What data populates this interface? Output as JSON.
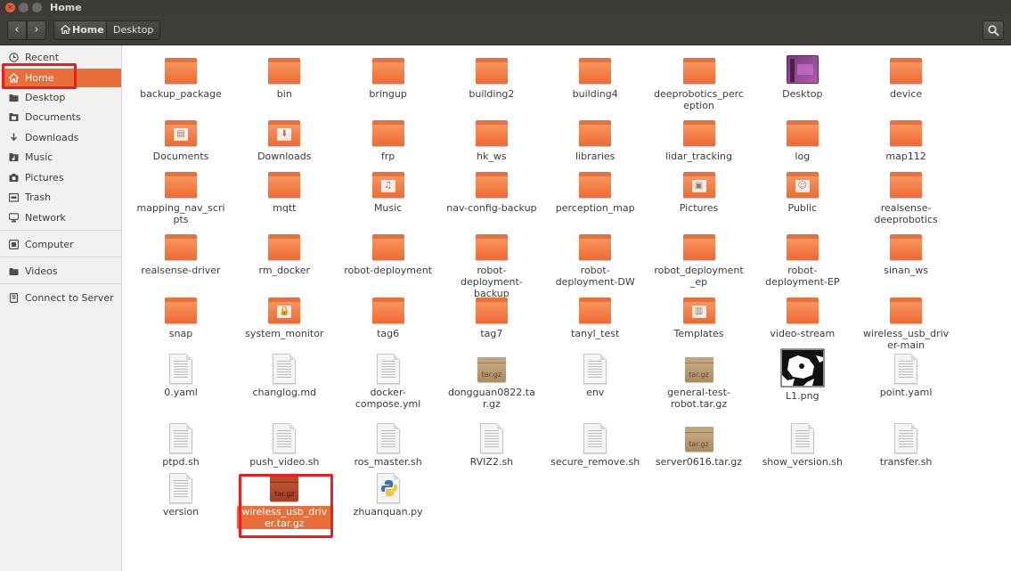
{
  "window": {
    "title": "Home"
  },
  "toolbar": {
    "back_icon": "‹",
    "forward_icon": "›",
    "breadcrumb": [
      "Home",
      "Desktop"
    ]
  },
  "sidebar": {
    "items": [
      {
        "label": "Recent",
        "icon": "clock-icon"
      },
      {
        "label": "Home",
        "icon": "home-icon",
        "active": true
      },
      {
        "label": "Desktop",
        "icon": "folder-icon"
      },
      {
        "label": "Documents",
        "icon": "document-icon"
      },
      {
        "label": "Downloads",
        "icon": "download-icon"
      },
      {
        "label": "Music",
        "icon": "music-icon"
      },
      {
        "label": "Pictures",
        "icon": "camera-icon"
      },
      {
        "label": "Trash",
        "icon": "trash-icon"
      },
      {
        "label": "Network",
        "icon": "network-icon"
      },
      {
        "label": "Computer",
        "icon": "computer-icon"
      },
      {
        "label": "Videos",
        "icon": "folder-icon"
      },
      {
        "label": "Connect to Server",
        "icon": "server-icon"
      }
    ]
  },
  "files": [
    {
      "name": "backup_package",
      "type": "folder"
    },
    {
      "name": "bin",
      "type": "folder"
    },
    {
      "name": "bringup",
      "type": "folder"
    },
    {
      "name": "building2",
      "type": "folder"
    },
    {
      "name": "building4",
      "type": "folder"
    },
    {
      "name": "deeprobotics_perception",
      "type": "folder"
    },
    {
      "name": "Desktop",
      "type": "desktop"
    },
    {
      "name": "device",
      "type": "folder"
    },
    {
      "name": "Documents",
      "type": "folder-documents"
    },
    {
      "name": "Downloads",
      "type": "folder-downloads"
    },
    {
      "name": "frp",
      "type": "folder"
    },
    {
      "name": "hk_ws",
      "type": "folder"
    },
    {
      "name": "libraries",
      "type": "folder"
    },
    {
      "name": "lidar_tracking",
      "type": "folder"
    },
    {
      "name": "log",
      "type": "folder"
    },
    {
      "name": "map112",
      "type": "folder"
    },
    {
      "name": "mapping_nav_scripts",
      "type": "folder"
    },
    {
      "name": "mqtt",
      "type": "folder"
    },
    {
      "name": "Music",
      "type": "folder-music"
    },
    {
      "name": "nav-config-backup",
      "type": "folder"
    },
    {
      "name": "perception_map",
      "type": "folder"
    },
    {
      "name": "Pictures",
      "type": "folder-pictures"
    },
    {
      "name": "Public",
      "type": "folder-public"
    },
    {
      "name": "realsense-deeprobotics",
      "type": "folder"
    },
    {
      "name": "realsense-driver",
      "type": "folder"
    },
    {
      "name": "rm_docker",
      "type": "folder"
    },
    {
      "name": "robot-deployment",
      "type": "folder"
    },
    {
      "name": "robot-deployment-backup",
      "type": "folder"
    },
    {
      "name": "robot-deployment-DW",
      "type": "folder"
    },
    {
      "name": "robot_deployment_ep",
      "type": "folder"
    },
    {
      "name": "robot-deployment-EP",
      "type": "folder"
    },
    {
      "name": "sinan_ws",
      "type": "folder"
    },
    {
      "name": "snap",
      "type": "folder"
    },
    {
      "name": "system_monitor",
      "type": "folder-locked"
    },
    {
      "name": "tag6",
      "type": "folder"
    },
    {
      "name": "tag7",
      "type": "folder"
    },
    {
      "name": "tanyl_test",
      "type": "folder"
    },
    {
      "name": "Templates",
      "type": "folder-templates"
    },
    {
      "name": "video-stream",
      "type": "folder"
    },
    {
      "name": "wireless_usb_driver-main",
      "type": "folder"
    },
    {
      "name": "0.yaml",
      "type": "text"
    },
    {
      "name": "changlog.md",
      "type": "text"
    },
    {
      "name": "docker-compose.yml",
      "type": "text"
    },
    {
      "name": "dongguan0822.tar.gz",
      "type": "archive"
    },
    {
      "name": "env",
      "type": "text"
    },
    {
      "name": "general-test-robot.tar.gz",
      "type": "archive"
    },
    {
      "name": "L1.png",
      "type": "image"
    },
    {
      "name": "point.yaml",
      "type": "text"
    },
    {
      "name": "ptpd.sh",
      "type": "script"
    },
    {
      "name": "push_video.sh",
      "type": "script"
    },
    {
      "name": "ros_master.sh",
      "type": "script"
    },
    {
      "name": "RVIZ2.sh",
      "type": "script"
    },
    {
      "name": "secure_remove.sh",
      "type": "script"
    },
    {
      "name": "server0616.tar.gz",
      "type": "archive"
    },
    {
      "name": "show_version.sh",
      "type": "script"
    },
    {
      "name": "transfer.sh",
      "type": "script"
    },
    {
      "name": "version",
      "type": "text"
    },
    {
      "name": "wireless_usb_driver.tar.gz",
      "type": "archive-selected",
      "selected": true
    },
    {
      "name": "zhuanquan.py",
      "type": "python"
    }
  ],
  "archive_label": "tar.gz",
  "colors": {
    "accent": "#e86f3a",
    "highlight": "#ee1c1c",
    "titlebar": "#3c3b37"
  }
}
